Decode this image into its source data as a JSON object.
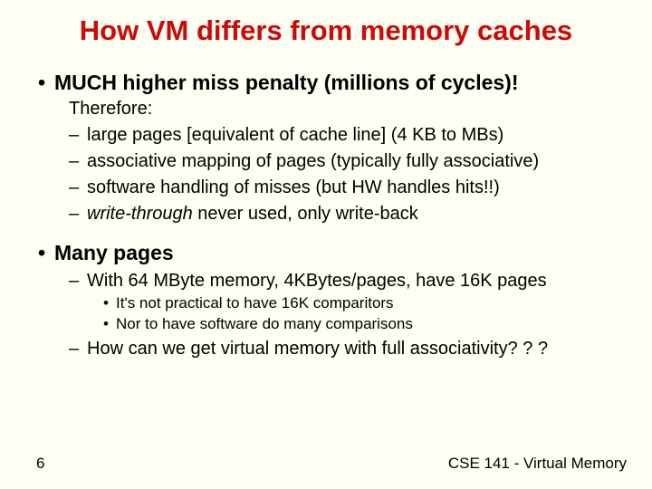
{
  "title": "How VM differs from memory caches",
  "bullets": {
    "b1a": "MUCH higher miss penalty (millions of cycles)!",
    "therefore": "Therefore:",
    "d1a": "large pages [equivalent of cache line] (4 KB to MBs)",
    "d1b": "associative mapping of pages (typically fully associative)",
    "d1c": "software handling of misses (but HW handles hits!!)",
    "d1d_pre": "write-through",
    "d1d_post": " never used, only write-back",
    "b1b": "Many pages",
    "d2a": "With 64 MByte memory, 4KBytes/pages, have 16K pages",
    "s3a": "It's not practical to have 16K comparitors",
    "s3b": "Nor to have software do many comparisons",
    "d2b": "How can we get virtual memory with full associativity? ? ?"
  },
  "footer": {
    "page": "6",
    "course": "CSE 141 - Virtual Memory"
  }
}
